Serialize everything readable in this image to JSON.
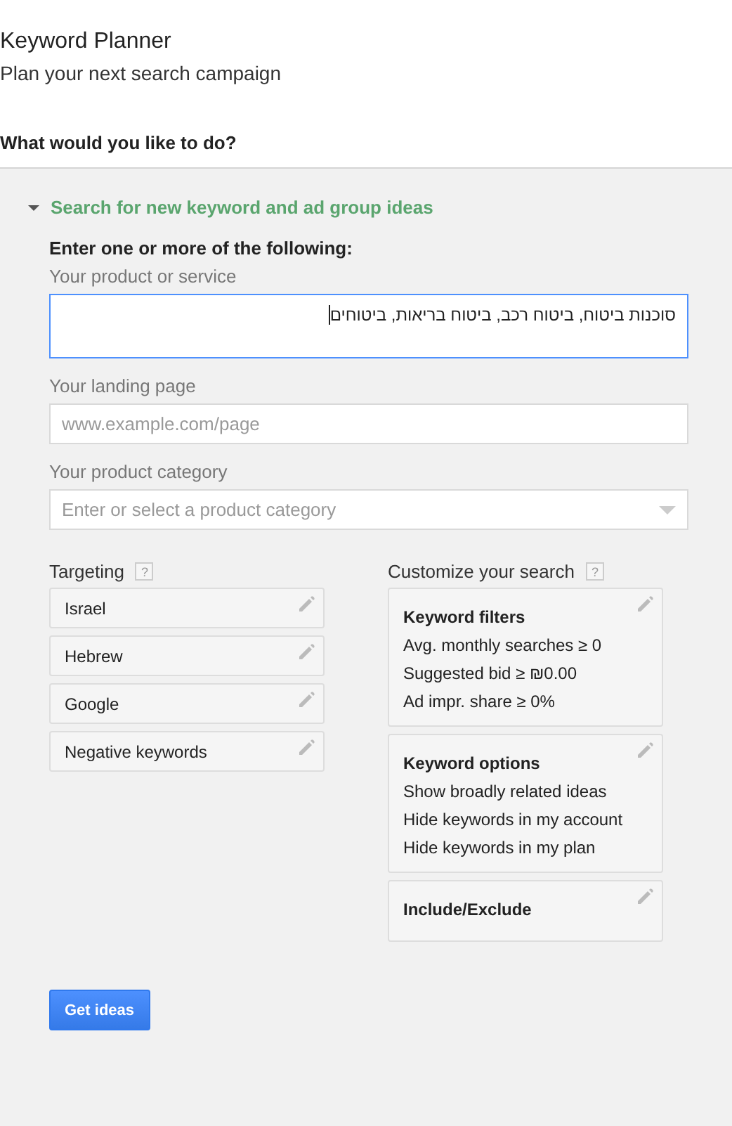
{
  "header": {
    "title": "Keyword Planner",
    "subtitle": "Plan your next search campaign"
  },
  "question": "What would you like to do?",
  "section": {
    "title": "Search for new keyword and ad group ideas",
    "expanded": true,
    "instructions": "Enter one or more of the following:",
    "fields": [
      {
        "kind": "textarea",
        "label": "Your product or service",
        "value": "סוכנות ביטוח, ביטוח רכב, ביטוח בריאות, ביטוחים",
        "focused": true
      },
      {
        "kind": "text",
        "label": "Your landing page",
        "placeholder": "www.example.com/page",
        "focused": false
      },
      {
        "kind": "select",
        "label": "Your product category",
        "placeholder": "Enter or select a product category",
        "focused": false
      }
    ],
    "targeting": {
      "title": "Targeting",
      "help": "?",
      "items": [
        "Israel",
        "Hebrew",
        "Google",
        "Negative keywords"
      ]
    },
    "customize": {
      "title": "Customize your search",
      "help": "?",
      "cards": [
        {
          "title": "Keyword filters",
          "lines": [
            "Avg. monthly searches ≥ 0",
            "Suggested bid ≥ ₪0.00",
            "Ad impr. share ≥ 0%"
          ]
        },
        {
          "title": "Keyword options",
          "lines": [
            "Show broadly related ideas",
            "Hide keywords in my account",
            "Hide keywords in my plan"
          ]
        },
        {
          "title": "Include/Exclude"
        }
      ]
    },
    "button": "Get ideas"
  }
}
